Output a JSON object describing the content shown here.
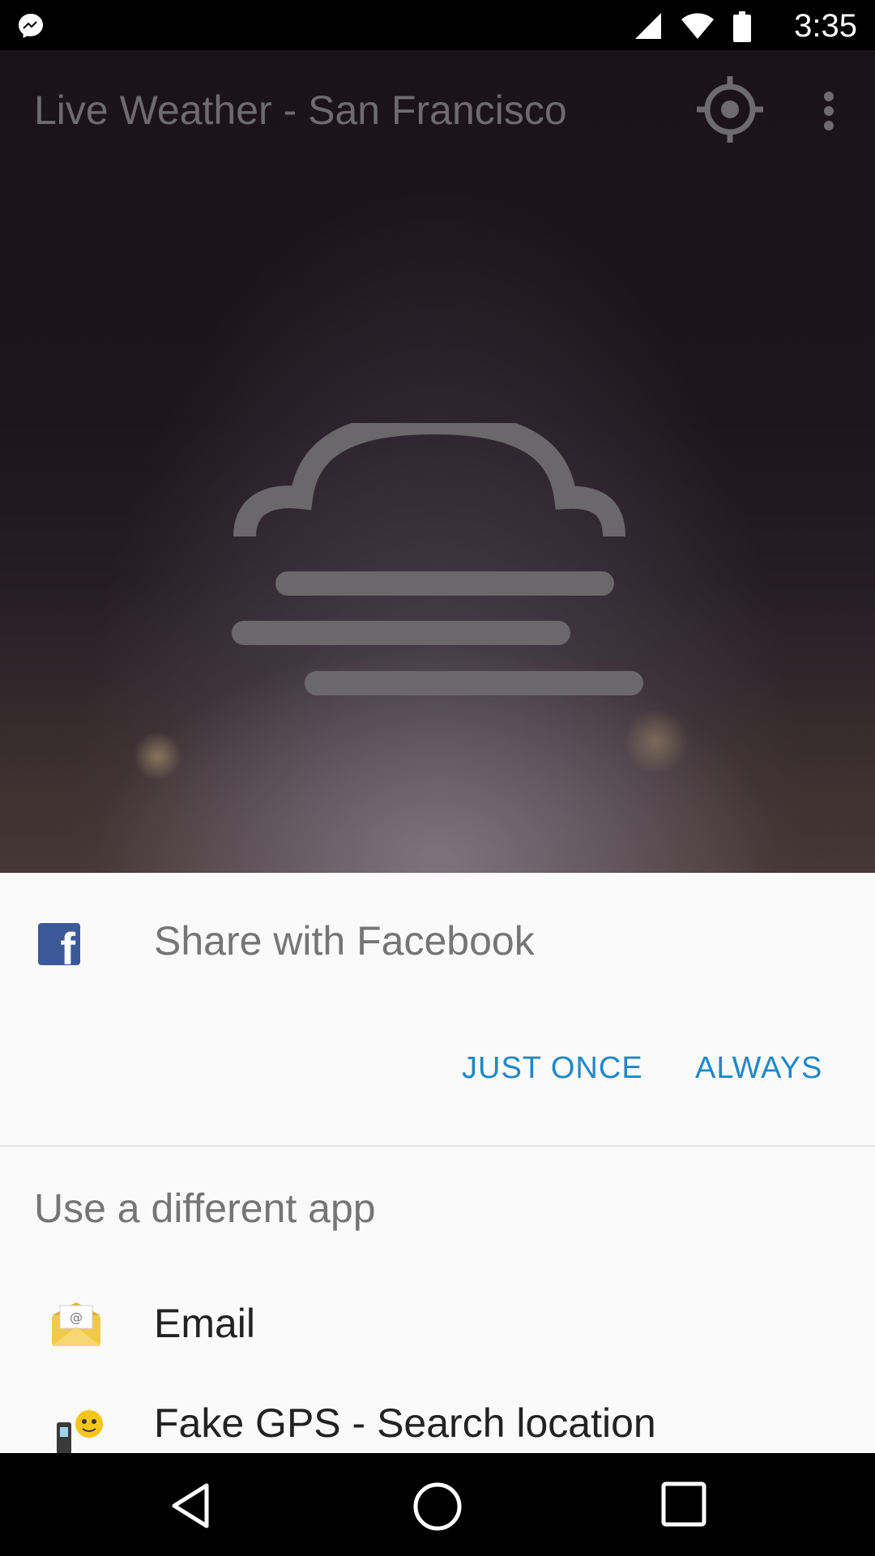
{
  "status_bar": {
    "time": "3:35",
    "icons": [
      "messenger-icon",
      "signal-icon",
      "wifi-icon",
      "battery-icon"
    ]
  },
  "app": {
    "title": "Live Weather - San Francisco",
    "actions": [
      "location-target-icon",
      "more-vert-icon"
    ],
    "condition_icon": "fog-icon"
  },
  "share_sheet": {
    "title": "Share with Facebook",
    "facebook_icon": "facebook-icon",
    "buttons": {
      "just_once": "JUST ONCE",
      "always": "ALWAYS"
    },
    "alt_title": "Use a different app",
    "apps": [
      {
        "label": "Email",
        "icon": "email-icon"
      },
      {
        "label": "Fake GPS - Search location",
        "icon": "fake-gps-icon"
      }
    ]
  },
  "nav_bar": {
    "icons": [
      "back-icon",
      "home-icon",
      "recents-icon"
    ]
  },
  "colors": {
    "accent": "#1e88c8",
    "facebook": "#3b5998",
    "sheet_bg": "#fafafa"
  }
}
